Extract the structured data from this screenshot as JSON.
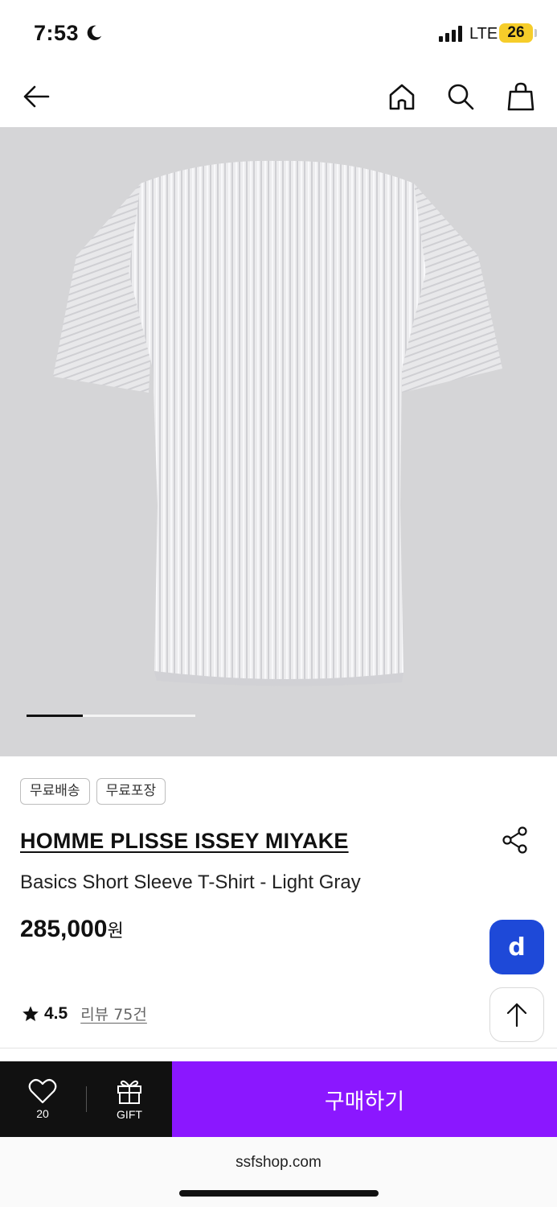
{
  "status_bar": {
    "time": "7:53",
    "network": "LTE",
    "battery": "26"
  },
  "nav": {
    "icons": [
      "arrow-left-icon",
      "home-icon",
      "search-icon",
      "shopping-bag-icon"
    ]
  },
  "product_image": {
    "alt": "Light gray pleated short sleeve t-shirt",
    "background": "#d5d5d7",
    "pager": {
      "current": 1,
      "total": 3
    }
  },
  "tags": [
    "무료배송",
    "무료포장"
  ],
  "product": {
    "brand": "HOMME PLISSE ISSEY MIYAKE",
    "name": "Basics Short Sleeve T-Shirt - Light Gray",
    "price": "285,000",
    "currency": "원",
    "rating": "4.5",
    "reviews": "리뷰 75건"
  },
  "floating": {
    "d_button": "d"
  },
  "action_bar": {
    "likes": "20",
    "gift_label": "GIFT",
    "buy_label": "구매하기",
    "buy_color": "#8b17ff"
  },
  "browser": {
    "url": "ssfshop.com"
  }
}
